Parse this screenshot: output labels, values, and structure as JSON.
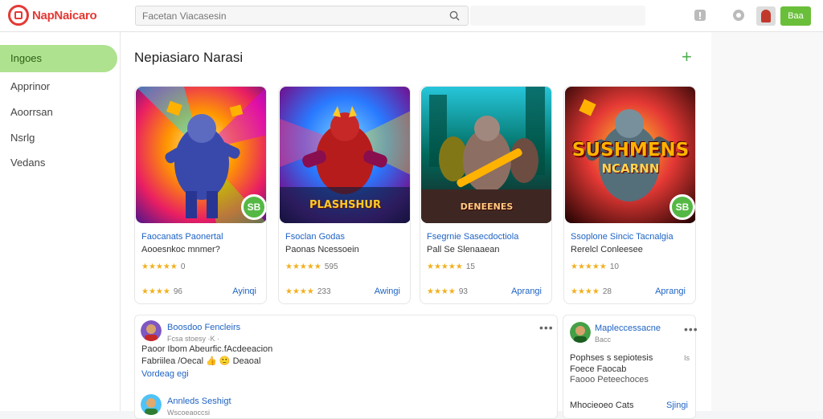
{
  "header": {
    "logo_text": "NapNaicaro",
    "search_placeholder": "Facetan Viacasesin",
    "button_label": "Baa"
  },
  "sidebar": {
    "items": [
      {
        "label": "Ingoes",
        "active": true
      },
      {
        "label": "Apprinor",
        "active": false
      },
      {
        "label": "Aoorrsan",
        "active": false
      },
      {
        "label": "Nsrlg",
        "active": false
      },
      {
        "label": "Vedans",
        "active": false
      }
    ]
  },
  "section": {
    "title": "Nepiasiaro Narasi"
  },
  "cards": [
    {
      "title": "Faocanats Paonertal",
      "subtitle": "Aooesnkoc mnmer?",
      "rating1": "★★★★★",
      "rating1_value": "0",
      "rating2": "★★★★",
      "rating2_value": "96",
      "link": "Ayinqi",
      "badge": "SB",
      "art_text": "",
      "accent": "#7c4dff"
    },
    {
      "title": "Fsoclan Godas",
      "subtitle": "Paonas Ncessoein",
      "rating1": "★★★★★",
      "rating1_value": "595",
      "rating2": "★★★★",
      "rating2_value": "233",
      "link": "Awingi",
      "badge": "",
      "art_text": "PLASHSHUR",
      "accent": "#3d5afe"
    },
    {
      "title": "Fsegrnie Sasecdoctiola",
      "subtitle": "Pall Se Slenaaean",
      "rating1": "★★★★★",
      "rating1_value": "15",
      "rating2": "★★★★",
      "rating2_value": "93",
      "link": "Aprangi",
      "badge": "",
      "art_text": "DENEENES",
      "accent": "#00897b"
    },
    {
      "title": "Ssoplone Sincic Tacnalgia",
      "subtitle": "Rerelcl Conleesee",
      "rating1": "★★★★★",
      "rating1_value": "10",
      "rating2": "★★★★",
      "rating2_value": "28",
      "link": "Aprangi",
      "badge": "SB",
      "art_text": "SUSHMENS",
      "art_text2": "NCARNN",
      "accent": "#c62828"
    }
  ],
  "posts": [
    {
      "name": "Boosdoo Fencleirs",
      "meta": "Fcsa stoesy ·K ·",
      "text": "Paoor Ibom Abeurfic.fAcdeeacion",
      "text2": "Fabriilea /Oecal 👍 🙂 Deaoal",
      "link": "Vordeag egi"
    },
    {
      "name": "Annleds Seshigt",
      "meta": "Wscoeaoccsi",
      "text": "",
      "text2": "",
      "link": ""
    }
  ],
  "side_post": {
    "name": "Mapleccessacne",
    "meta": "Bacc",
    "line1": "Pophses s sepiotesis",
    "line1_right": "Is",
    "line2": "Foece Faocab",
    "line3": "Faooo Peteechoces",
    "footer_left": "Mhocieoeo Cats",
    "footer_link": "Sjingi"
  }
}
